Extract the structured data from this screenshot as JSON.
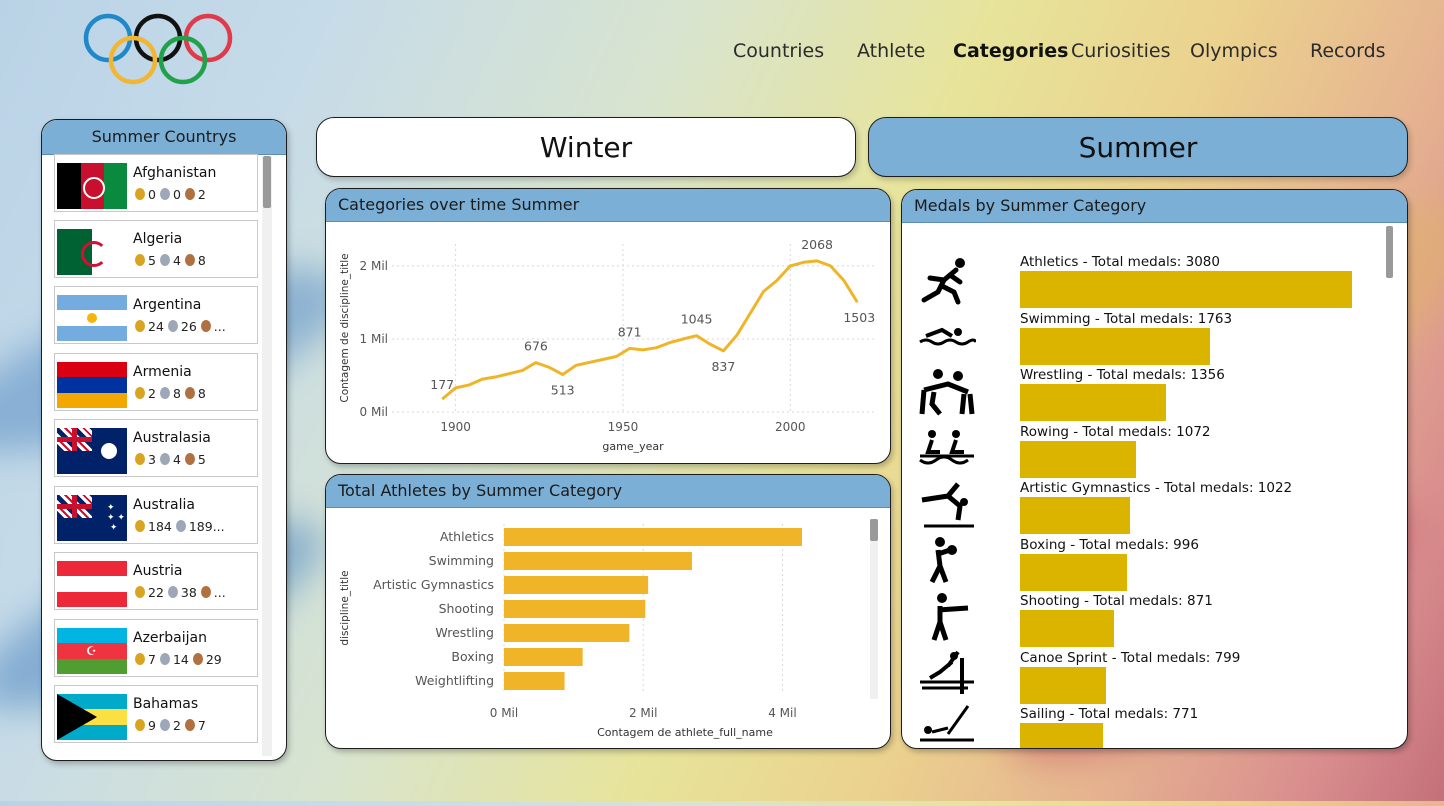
{
  "nav": {
    "items": [
      {
        "label": "Countries"
      },
      {
        "label": "Athlete"
      },
      {
        "label": "Categories"
      },
      {
        "label": "Curiosities"
      },
      {
        "label": "Olympics"
      },
      {
        "label": "Records"
      }
    ],
    "active": "Categories"
  },
  "toggles": {
    "winter": "Winter",
    "summer": "Summer"
  },
  "countries_panel": {
    "title": "Summer Countrys",
    "items": [
      {
        "name": "Afghanistan",
        "gold": "0",
        "silver": "0",
        "bronze": "2"
      },
      {
        "name": "Algeria",
        "gold": "5",
        "silver": "4",
        "bronze": "8"
      },
      {
        "name": "Argentina",
        "gold": "24",
        "silver": "26",
        "bronze": "..."
      },
      {
        "name": "Armenia",
        "gold": "2",
        "silver": "8",
        "bronze": "8"
      },
      {
        "name": "Australasia",
        "gold": "3",
        "silver": "4",
        "bronze": "5"
      },
      {
        "name": "Australia",
        "gold": "184",
        "silver": "189...",
        "bronze": ""
      },
      {
        "name": "Austria",
        "gold": "22",
        "silver": "38",
        "bronze": "..."
      },
      {
        "name": "Azerbaijan",
        "gold": "7",
        "silver": "14",
        "bronze": "29"
      },
      {
        "name": "Bahamas",
        "gold": "9",
        "silver": "2",
        "bronze": "7"
      }
    ]
  },
  "line_panel": {
    "title": "Categories over time Summer"
  },
  "bar_panel": {
    "title": "Total Athletes by Summer Category"
  },
  "medals_panel": {
    "title": "Medals by Summer Category",
    "items": [
      {
        "label": "Athletics - Total medals: 3080",
        "value": 3080,
        "icon": "athletics-icon"
      },
      {
        "label": "Swimming - Total medals: 1763",
        "value": 1763,
        "icon": "swimming-icon"
      },
      {
        "label": "Wrestling - Total medals: 1356",
        "value": 1356,
        "icon": "wrestling-icon"
      },
      {
        "label": "Rowing - Total medals: 1072",
        "value": 1072,
        "icon": "rowing-icon"
      },
      {
        "label": "Artistic Gymnastics - Total medals: 1022",
        "value": 1022,
        "icon": "gymnastics-icon"
      },
      {
        "label": "Boxing - Total medals: 996",
        "value": 996,
        "icon": "boxing-icon"
      },
      {
        "label": "Shooting - Total medals: 871",
        "value": 871,
        "icon": "shooting-icon"
      },
      {
        "label": "Canoe Sprint - Total medals: 799",
        "value": 799,
        "icon": "canoe-icon"
      },
      {
        "label": "Sailing - Total medals: 771",
        "value": 771,
        "icon": "sailing-icon"
      }
    ]
  },
  "colors": {
    "panel_header": "#7bafd6",
    "line": "#f0b429",
    "bar": "#f0b429",
    "medal_bar": "#dbb400"
  },
  "chart_data": [
    {
      "type": "line",
      "title": "Categories over time Summer",
      "xlabel": "game_year",
      "ylabel": "Contagem de discipline_title",
      "x_ticks": [
        "1900",
        "1950",
        "2000"
      ],
      "y_ticks": [
        "0 Mil",
        "1 Mil",
        "2 Mil"
      ],
      "xlim": [
        1881,
        2025
      ],
      "ylim": [
        0,
        2300
      ],
      "x": [
        1896,
        1900,
        1904,
        1908,
        1912,
        1920,
        1924,
        1928,
        1932,
        1936,
        1948,
        1952,
        1956,
        1960,
        1964,
        1968,
        1972,
        1976,
        1980,
        1984,
        1988,
        1992,
        1996,
        2000,
        2004,
        2008,
        2012,
        2016,
        2020
      ],
      "y": [
        177,
        330,
        370,
        450,
        480,
        570,
        676,
        610,
        513,
        640,
        760,
        871,
        850,
        880,
        950,
        1000,
        1045,
        930,
        837,
        1050,
        1350,
        1650,
        1800,
        2000,
        2050,
        2068,
        2000,
        1800,
        1503
      ],
      "data_labels": [
        {
          "x": 1896,
          "y": 177,
          "text": "177"
        },
        {
          "x": 1924,
          "y": 676,
          "text": "676"
        },
        {
          "x": 1932,
          "y": 513,
          "text": "513"
        },
        {
          "x": 1952,
          "y": 871,
          "text": "871"
        },
        {
          "x": 1972,
          "y": 1045,
          "text": "1045"
        },
        {
          "x": 1980,
          "y": 837,
          "text": "837"
        },
        {
          "x": 2008,
          "y": 2068,
          "text": "2068"
        },
        {
          "x": 2020,
          "y": 1503,
          "text": "1503"
        }
      ],
      "grid": true
    },
    {
      "type": "bar",
      "orientation": "horizontal",
      "title": "Total Athletes by Summer Category",
      "xlabel": "Contagem de athlete_full_name",
      "ylabel": "discipline_title",
      "categories": [
        "Athletics",
        "Swimming",
        "Artistic Gymnastics",
        "Shooting",
        "Wrestling",
        "Boxing",
        "Weightlifting"
      ],
      "values": [
        4280,
        2700,
        2070,
        2030,
        1800,
        1130,
        870
      ],
      "x_ticks": [
        "0 Mil",
        "2 Mil",
        "4 Mil"
      ],
      "xlim": [
        0,
        5200
      ],
      "grid": true
    }
  ]
}
